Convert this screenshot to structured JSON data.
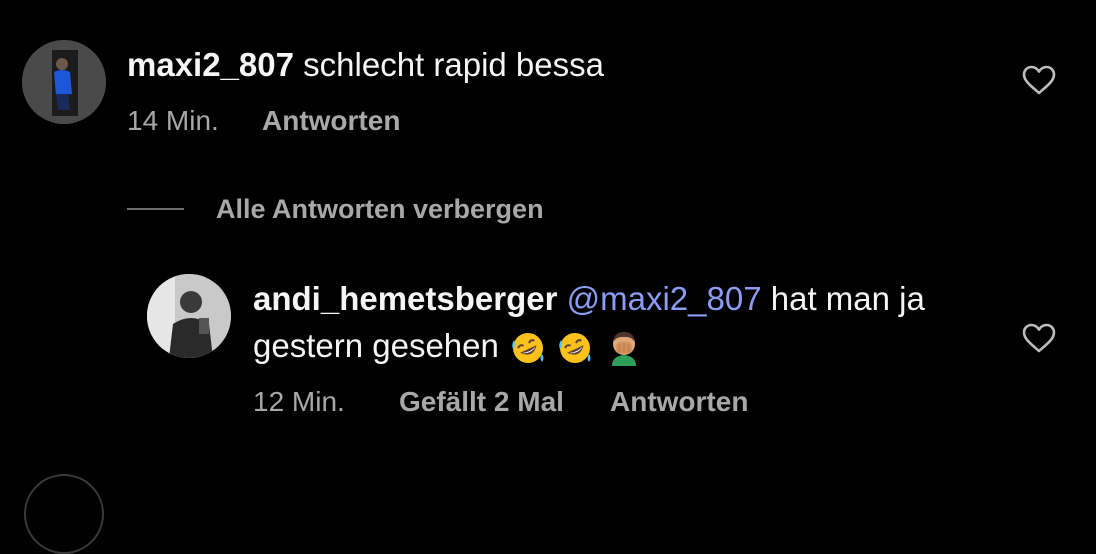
{
  "colors": {
    "background": "#000000",
    "text": "#f5f5f5",
    "meta": "#a8a8a8",
    "mention": "#8b9cf2"
  },
  "comment": {
    "username": "maxi2_807",
    "text": "schlecht rapid bessa",
    "time": "14 Min.",
    "reply_label": "Antworten",
    "like_icon": "heart-outline-icon"
  },
  "hide_replies": {
    "label": "Alle Antworten verbergen"
  },
  "reply": {
    "username": "andi_hemetsberger",
    "mention": "@maxi2_807",
    "text_line1_rest": "hat man ja",
    "text_line2": "gestern gesehen",
    "emojis": [
      "rofl-emoji",
      "rofl-emoji",
      "man-facepalming-emoji"
    ],
    "time": "12 Min.",
    "likes_label": "Gefällt 2 Mal",
    "reply_label": "Antworten",
    "like_icon": "heart-outline-icon"
  }
}
